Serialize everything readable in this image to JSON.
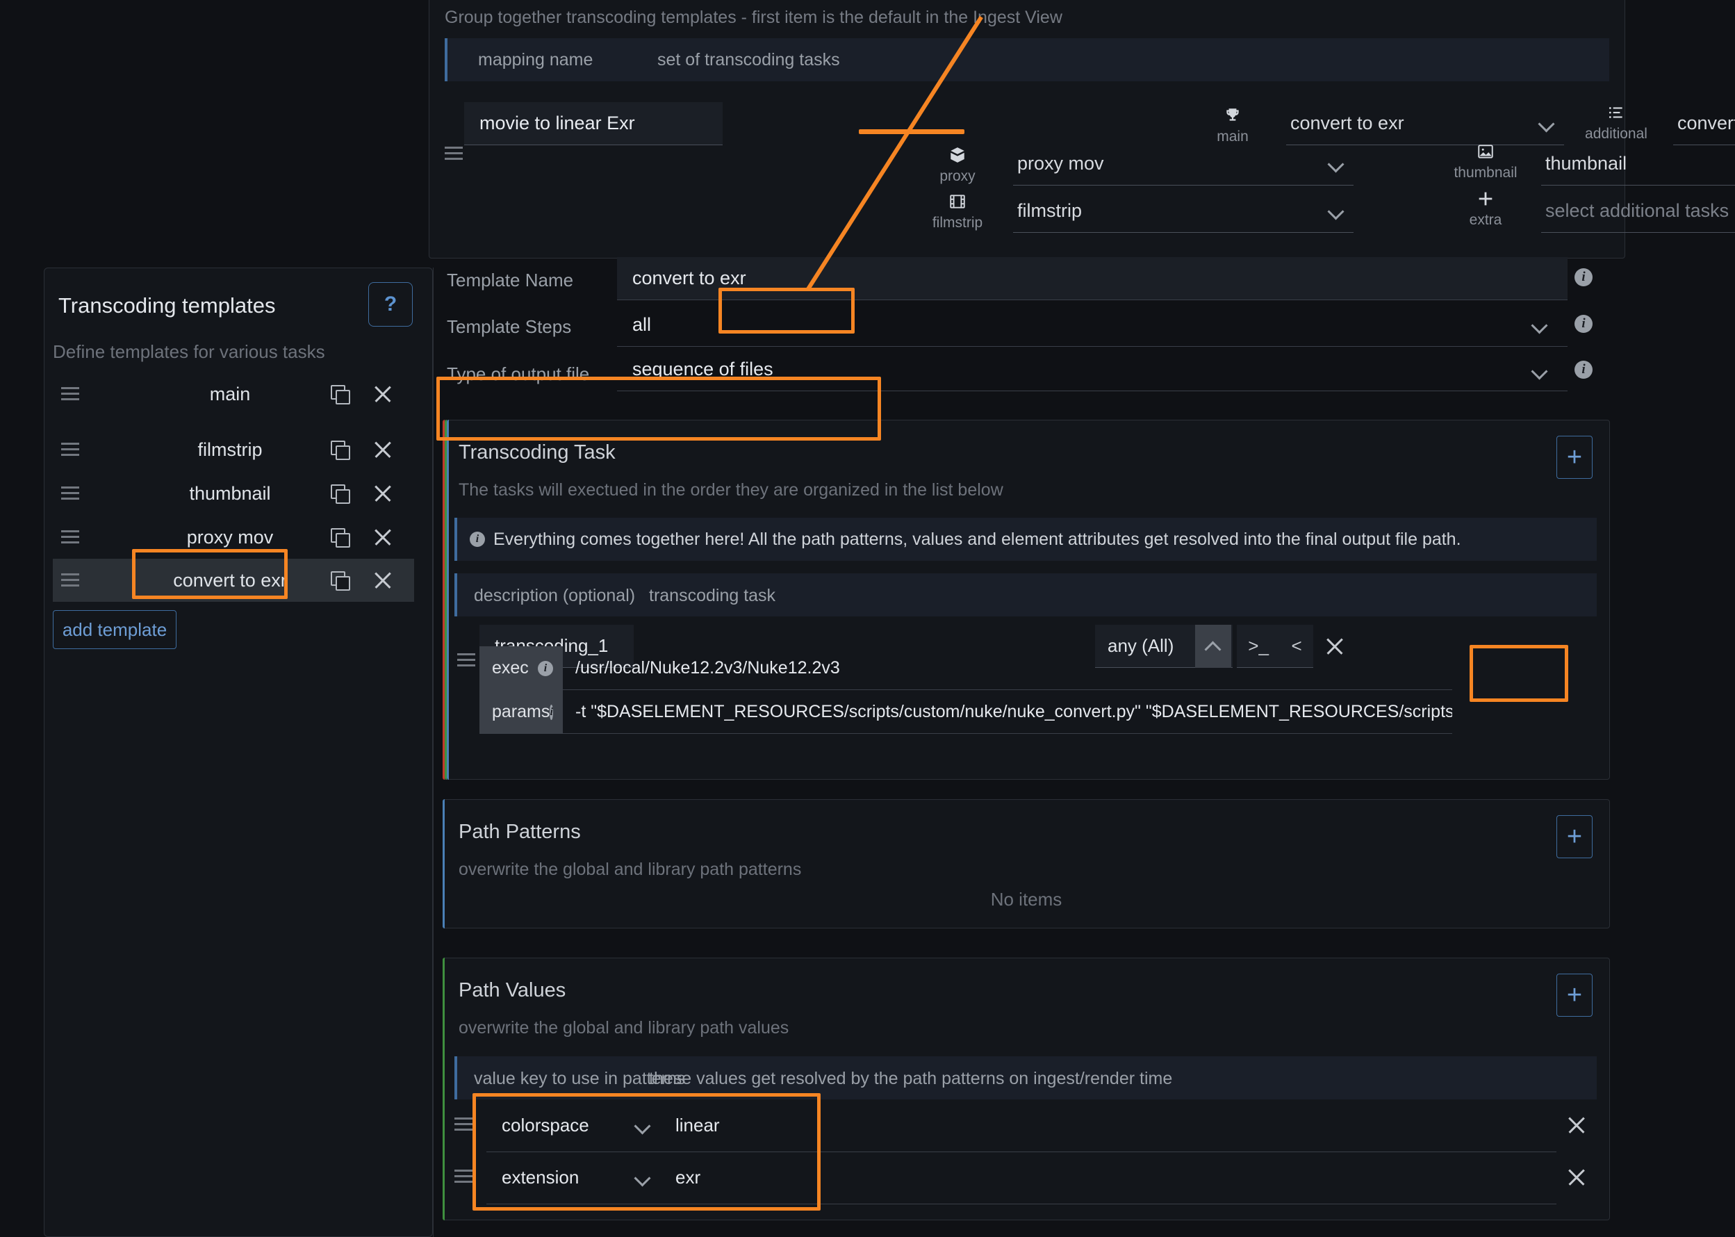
{
  "colors": {
    "accent_orange": "#f68523",
    "accent_blue": "#3f6c9e",
    "stripe_red": "#c0392b",
    "stripe_green": "#3f8f3f",
    "stripe_blue": "#4a7fb5",
    "bg": "#0f1115",
    "panel": "#13161b"
  },
  "mapping_panel": {
    "subtitle": "Group together transcoding templates - first item is the default in the Ingest View",
    "header": {
      "col1": "mapping name",
      "col2": "set of transcoding tasks"
    },
    "row": {
      "mapping_name": "movie to linear Exr",
      "main": {
        "icon": "trophy-icon",
        "caption": "main",
        "value": "convert to exr"
      },
      "additional": {
        "icon": "list-bullet-icon",
        "caption": "additional",
        "value": "convert to exr"
      },
      "proxy": {
        "icon": "package-icon",
        "caption": "proxy",
        "value": "proxy mov"
      },
      "filmstrip": {
        "icon": "film-icon",
        "caption": "filmstrip",
        "value": "filmstrip"
      },
      "thumbnail": {
        "icon": "image-icon",
        "caption": "thumbnail",
        "value": "thumbnail"
      },
      "extra": {
        "icon": "plus-icon",
        "caption": "extra",
        "placeholder": "select additional tasks"
      }
    }
  },
  "sidebar": {
    "title": "Transcoding templates",
    "help_label": "?",
    "description": "Define templates for various tasks",
    "items": [
      {
        "label": "main",
        "selected": false
      },
      {
        "label": "filmstrip",
        "selected": false
      },
      {
        "label": "thumbnail",
        "selected": false
      },
      {
        "label": "proxy mov",
        "selected": false
      },
      {
        "label": "convert to exr",
        "selected": true
      }
    ],
    "add_button": "add template"
  },
  "detail": {
    "template_name": {
      "label": "Template Name",
      "value": "convert to exr"
    },
    "template_steps": {
      "label": "Template Steps",
      "value": "all"
    },
    "output_type": {
      "label": "Type of output file",
      "value": "sequence of files"
    },
    "transcoding_task": {
      "title": "Transcoding Task",
      "description": "The tasks will exectued in the order they are organized in the list below",
      "info_note": "Everything comes together here! All the path patterns, values and element attributes get resolved into the final output file path.",
      "table_header": {
        "col1": "description (optional)",
        "col2": "transcoding task"
      },
      "task": {
        "name": "transcoding_1",
        "scope": "any (All)",
        "fields": [
          {
            "key": "exec",
            "value": "/usr/local/Nuke12.2v3/Nuke12.2v3"
          },
          {
            "key": "params",
            "value": "-t \"$DASELEMENT_RESOURCES/scripts/custom/nuke/nuke_convert.py\" \"$DASELEMENT_RESOURCES/scripts/custom/nuke/nuke_convert_lin"
          }
        ]
      },
      "add_label": "+"
    },
    "path_patterns": {
      "title": "Path Patterns",
      "description": "overwrite the global and library path patterns",
      "empty_text": "No items",
      "add_label": "+"
    },
    "path_values": {
      "title": "Path Values",
      "description": "overwrite the global and library path values",
      "table_header": {
        "col1": "value key to use in patterns",
        "col2": "these values get resolved by the path patterns on ingest/render time"
      },
      "rows": [
        {
          "key": "colorspace",
          "value": "linear"
        },
        {
          "key": "extension",
          "value": "exr"
        }
      ],
      "add_label": "+"
    }
  }
}
